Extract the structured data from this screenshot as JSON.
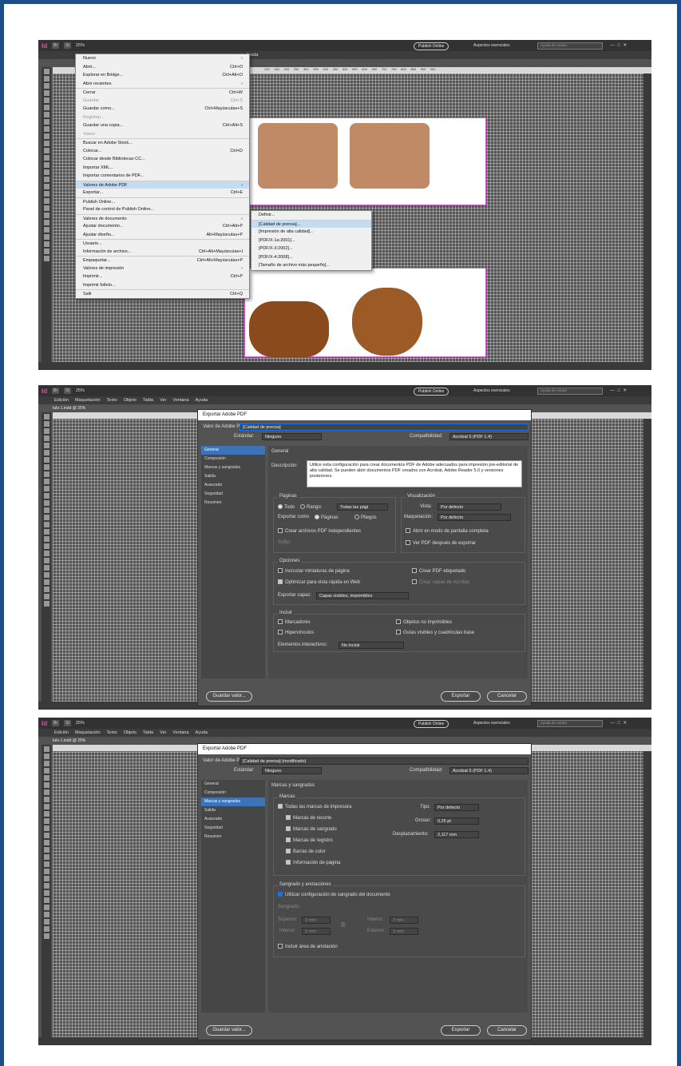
{
  "app": {
    "logo": "Id",
    "bridge_badge": "Br",
    "stock_badge": "St",
    "zoom": "25%",
    "publish_online": "Publish Online",
    "workspace": "Aspectos esenciales",
    "help_placeholder": "Ayuda de Adobe",
    "doc_tab": "tulo-1.indd @ 25%",
    "menus": [
      "Edición",
      "Maquetación",
      "Texto",
      "Objeto",
      "Tabla",
      "Ver",
      "Ventana",
      "Ayuda"
    ]
  },
  "file_menu": {
    "items": [
      {
        "label": "Nuevo",
        "shortcut": "›"
      },
      {
        "label": "Abrir...",
        "shortcut": "Ctrl+O"
      },
      {
        "label": "Explorar en Bridge...",
        "shortcut": "Ctrl+Alt+O"
      },
      {
        "label": "Abrir recientes",
        "shortcut": "›"
      },
      {
        "label": "Cerrar",
        "shortcut": "Ctrl+W",
        "sep": true
      },
      {
        "label": "Guardar",
        "shortcut": "Ctrl+S",
        "dis": true
      },
      {
        "label": "Guardar como...",
        "shortcut": "Ctrl+Mayúsculas+S"
      },
      {
        "label": "Registrar...",
        "shortcut": "",
        "dis": true
      },
      {
        "label": "Guardar una copia...",
        "shortcut": "Ctrl+Alt+S"
      },
      {
        "label": "Volver",
        "shortcut": "",
        "dis": true
      },
      {
        "label": "Buscar en Adobe Stock...",
        "shortcut": "",
        "sep": true
      },
      {
        "label": "Colocar...",
        "shortcut": "Ctrl+D"
      },
      {
        "label": "Colocar desde Bibliotecas CC...",
        "shortcut": ""
      },
      {
        "label": "Importar XML...",
        "shortcut": ""
      },
      {
        "label": "Importar comentarios de PDF...",
        "shortcut": ""
      },
      {
        "label": "Valores de Adobe PDF",
        "shortcut": "›",
        "hl": true,
        "sep": true
      },
      {
        "label": "Exportar...",
        "shortcut": "Ctrl+E"
      },
      {
        "label": "Publish Online...",
        "shortcut": "",
        "sep": true
      },
      {
        "label": "Panel de control de Publish Online...",
        "shortcut": ""
      },
      {
        "label": "Valores de documento",
        "shortcut": "›",
        "sep": true
      },
      {
        "label": "Ajustar documento...",
        "shortcut": "Ctrl+Alt+P"
      },
      {
        "label": "Ajustar diseño...",
        "shortcut": "Alt+Mayúsculas+P"
      },
      {
        "label": "Usuario...",
        "shortcut": "",
        "sep": true
      },
      {
        "label": "Información de archivo...",
        "shortcut": "Ctrl+Alt+Mayúsculas+I"
      },
      {
        "label": "Empaquetar...",
        "shortcut": "Ctrl+Alt+Mayúsculas+P",
        "sep": true
      },
      {
        "label": "Valores de impresión",
        "shortcut": "›"
      },
      {
        "label": "Imprimir...",
        "shortcut": "Ctrl+P"
      },
      {
        "label": "Imprimir folleto...",
        "shortcut": ""
      },
      {
        "label": "Salir",
        "shortcut": "Ctrl+Q",
        "sep": true
      }
    ]
  },
  "pdf_submenu": {
    "items": [
      {
        "label": "Definir..."
      },
      {
        "label": "[Calidad de prensa]...",
        "hl": true,
        "sep": true
      },
      {
        "label": "[Impresión de alta calidad]..."
      },
      {
        "label": "[PDF/X-1a:2001]..."
      },
      {
        "label": "[PDF/X-3:2002]..."
      },
      {
        "label": "[PDF/X-4:2008]..."
      },
      {
        "label": "[Tamaño de archivo más pequeño]..."
      }
    ]
  },
  "dialog": {
    "title": "Exportar Adobe PDF",
    "preset_label": "Valor de Adobe PDF:",
    "preset_value_1": "[Calidad de prensa]",
    "preset_value_2": "[Calidad de prensa] (modificado)",
    "standard_label": "Estándar:",
    "standard_value": "Ninguno",
    "compat_label": "Compatibilidad:",
    "compat_value": "Acrobat 5 (PDF 1.4)",
    "sections": [
      "General",
      "Compresión",
      "Marcas y sangrados",
      "Salida",
      "Avanzado",
      "Seguridad",
      "Resumen"
    ],
    "save_preset": "Guardar valor...",
    "export": "Exportar",
    "cancel": "Cancelar"
  },
  "general": {
    "heading": "General",
    "desc_label": "Descripción:",
    "description": "Utilice esta configuración para crear documentos PDF de Adobe adecuados para impresión pre-editorial de alta calidad. Se pueden abrir documentos PDF creados con Acrobat, Adobe Reader 5.0 y versiones posteriores.",
    "pages_title": "Páginas",
    "all": "Todo",
    "range": "Rango:",
    "range_value": "Todas las pági",
    "export_as": "Exportar como",
    "pages": "Páginas",
    "spreads": "Pliegos",
    "separate_files": "Crear archivos PDF independientes",
    "suffix": "Sufijo:",
    "view_title": "Visualización",
    "view_label": "Vista:",
    "view_value": "Por defecto",
    "layout_label": "Maquetación:",
    "layout_value": "Por defecto",
    "fullscreen": "Abrir en modo de pantalla completa",
    "view_after": "Ver PDF después de exportar",
    "options_title": "Opciones",
    "thumbnails": "Incrustar miniaturas de página",
    "optimize": "Optimizar para vista rápida en Web",
    "tagged": "Crear PDF etiquetado",
    "acrobat_layers": "Crear capas de Acrobat",
    "export_layers_label": "Exportar capas:",
    "export_layers_value": "Capas visibles, imprimibles",
    "include_title": "Incluir",
    "bookmarks": "Marcadores",
    "hyperlinks": "Hipervínculos",
    "nonprinting": "Objetos no imprimibles",
    "guides": "Guías visibles y cuadrículas base",
    "interactive_label": "Elementos interactivos:",
    "interactive_value": "No incluir"
  },
  "marks": {
    "heading": "Marcas y sangrados",
    "marks_title": "Marcas",
    "all_marks": "Todas las marcas de impresora",
    "crop": "Marcas de recorte",
    "bleed": "Marcas de sangrado",
    "registration": "Marcas de registro",
    "color_bars": "Barras de color",
    "page_info": "Información de página",
    "type_label": "Tipo:",
    "type_value": "Por defecto",
    "weight_label": "Grosor:",
    "weight_value": "0,25 pt",
    "offset_label": "Desplazamiento:",
    "offset_value": "2,117 mm",
    "bleed_title": "Sangrado y anotaciones",
    "use_doc_bleed": "Utilizar configuración de sangrado del documento",
    "bleed_label": "Sangrado:",
    "top": "Superior:",
    "bottom": "Inferior:",
    "inside": "Interior:",
    "outside": "Exterior:",
    "mm3": "3 mm",
    "slug": "Incluir área de anotación"
  },
  "colors": {
    "accent": "#1473e6",
    "frame": "#1d4e89",
    "menu_highlight": "#c3dcf4",
    "sidebar_sel": "#3d74b8"
  }
}
